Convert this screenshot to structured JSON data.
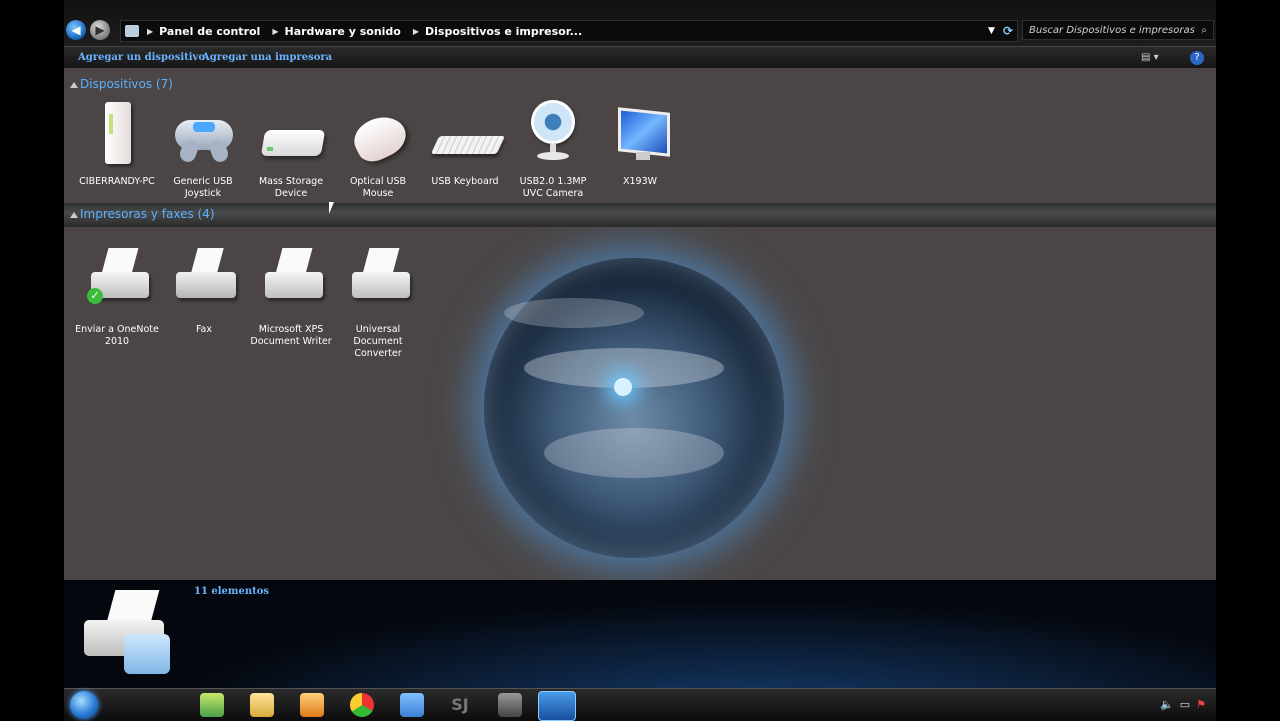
{
  "address_bar": {
    "breadcrumbs": [
      "Panel de control",
      "Hardware y sonido",
      "Dispositivos e impresor..."
    ]
  },
  "search": {
    "placeholder": "Buscar Dispositivos e impresoras"
  },
  "toolbar": {
    "add_device": "Agregar un dispositivo",
    "add_printer": "Agregar una impresora"
  },
  "groups": {
    "devices": {
      "title": "Dispositivos (7)",
      "items": [
        {
          "label": "CIBERRANDY-PC",
          "icon": "computer-tower-icon"
        },
        {
          "label": "Generic   USB Joystick",
          "icon": "gamepad-icon"
        },
        {
          "label": "Mass Storage Device",
          "icon": "external-drive-icon"
        },
        {
          "label": "Optical USB Mouse",
          "icon": "mouse-icon"
        },
        {
          "label": "USB Keyboard",
          "icon": "keyboard-icon"
        },
        {
          "label": "USB2.0 1.3MP UVC Camera",
          "icon": "webcam-icon"
        },
        {
          "label": "X193W",
          "icon": "monitor-icon"
        }
      ]
    },
    "printers": {
      "title": "Impresoras y faxes (4)",
      "items": [
        {
          "label": "Enviar a OneNote 2010",
          "icon": "printer-default-icon"
        },
        {
          "label": "Fax",
          "icon": "fax-icon"
        },
        {
          "label": "Microsoft XPS Document Writer",
          "icon": "printer-icon"
        },
        {
          "label": "Universal Document Converter",
          "icon": "printer-icon"
        }
      ]
    }
  },
  "status": {
    "count": "11 elementos"
  },
  "taskbar": {
    "sj_label": "SJ"
  }
}
